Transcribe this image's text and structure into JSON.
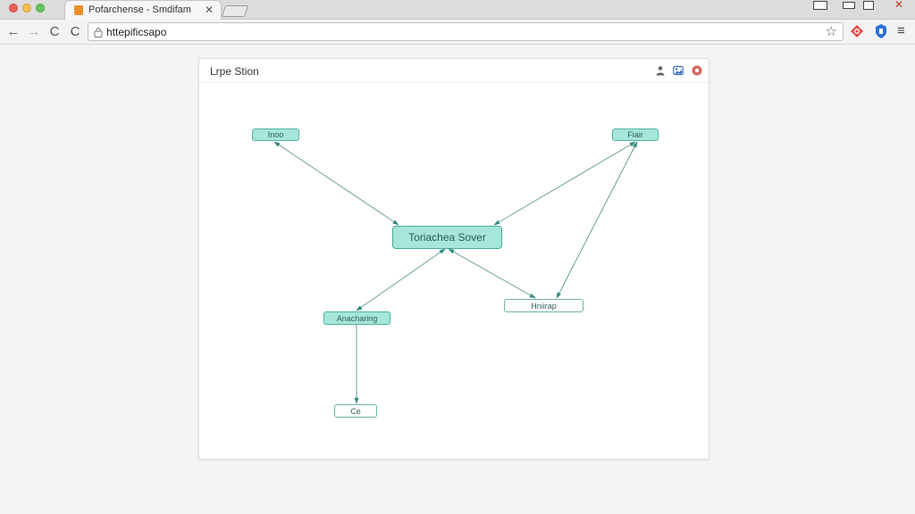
{
  "browser": {
    "tab": {
      "title": "Pofarchense - Smdifam",
      "close_glyph": "✕"
    },
    "address": {
      "url": "httepificsapo"
    },
    "nav": {
      "back": "←",
      "forward": "→",
      "reload": "C",
      "reload_alt": "C"
    },
    "icons": {
      "favicon": "app-favicon-icon",
      "lock": "lock-icon",
      "star": "bookmark-star-icon",
      "extension_1": "red-extension-icon",
      "extension_2": "blue-extension-icon",
      "menu": "menu-icon"
    },
    "menu_glyph": "≡",
    "star_glyph": "☆",
    "window_close_glyph": "✕"
  },
  "panel": {
    "title": "Lrpe Stion",
    "icons": [
      "user-icon",
      "image-icon",
      "settings-icon"
    ]
  },
  "diagram": {
    "nodes": {
      "top_left": {
        "label": "Inoo",
        "style": "filled"
      },
      "top_right": {
        "label": "Fiair",
        "style": "filled"
      },
      "center": {
        "label": "Toriachea Sover",
        "style": "filled"
      },
      "mid_left": {
        "label": "Anacharing",
        "style": "filled"
      },
      "mid_right": {
        "label": "Hniirap",
        "style": "outline"
      },
      "bottom": {
        "label": "Ce",
        "style": "outline"
      }
    },
    "edges": [
      {
        "from": "top_left",
        "to": "center",
        "arrow_at": "both"
      },
      {
        "from": "top_right",
        "to": "center",
        "arrow_at": "both"
      },
      {
        "from": "top_right",
        "to": "mid_right",
        "arrow_at": "both"
      },
      {
        "from": "center",
        "to": "mid_left",
        "arrow_at": "both"
      },
      {
        "from": "center",
        "to": "mid_right",
        "arrow_at": "both"
      },
      {
        "from": "mid_left",
        "to": "bottom",
        "arrow_at": "to"
      }
    ]
  },
  "colors": {
    "node_fill": "#a6e6db",
    "node_border": "#4fb3a3",
    "edge": "#6b9e96",
    "arrow": "#2e8a7c"
  }
}
